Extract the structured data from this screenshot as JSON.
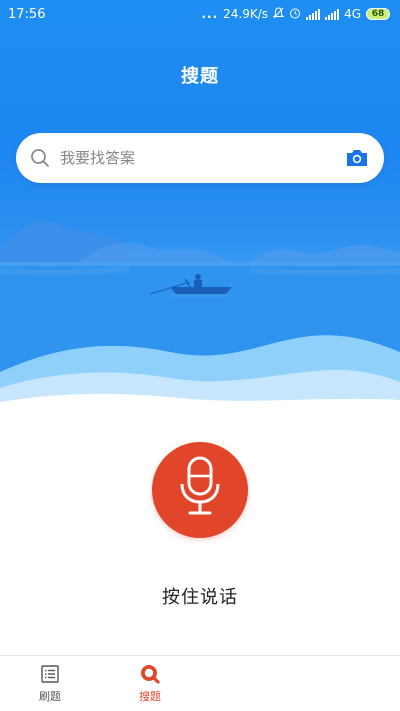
{
  "status_bar": {
    "time": "17:56",
    "dots": "...",
    "speed": "24.9K/s",
    "network": "4G",
    "battery": "68"
  },
  "header": {
    "title": "搜题"
  },
  "search": {
    "placeholder": "我要找答案"
  },
  "voice": {
    "hint": "按住说话"
  },
  "tabs": [
    {
      "label": "刷题",
      "icon": "list-icon"
    },
    {
      "label": "搜题",
      "icon": "search-tab-icon",
      "active": true
    }
  ],
  "colors": {
    "accent": "#e2462a",
    "primary": "#1e8ef2",
    "camera": "#1a73e8"
  }
}
